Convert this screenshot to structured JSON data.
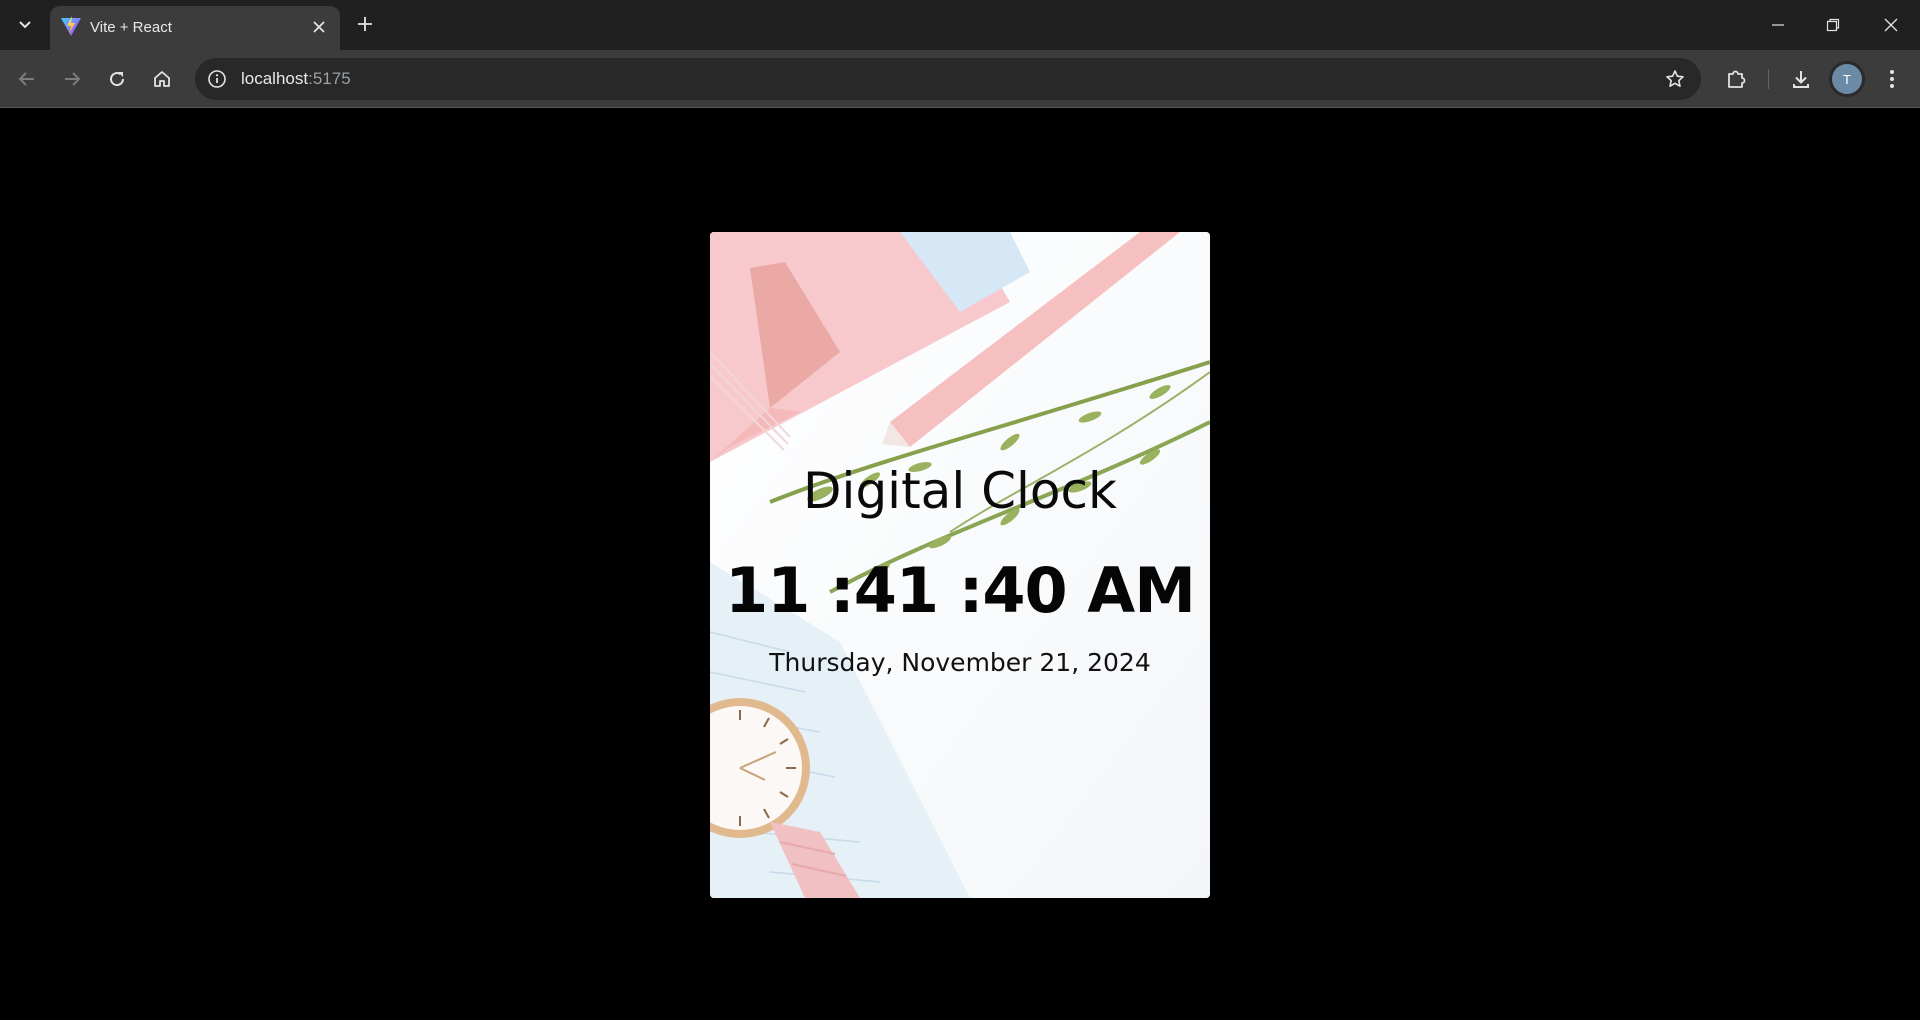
{
  "browser": {
    "tab": {
      "title": "Vite + React",
      "favicon": "vite-logo-icon"
    },
    "address_bar": {
      "host": "localhost",
      "port": ":5175"
    },
    "profile_initial": "T",
    "icons": [
      "tab-search-icon",
      "close-icon",
      "plus-icon",
      "minimize-icon",
      "restore-icon",
      "close-window-icon",
      "back-arrow-icon",
      "forward-arrow-icon",
      "reload-icon",
      "home-icon",
      "site-info-icon",
      "bookmark-star-icon",
      "extensions-icon",
      "download-icon",
      "kebab-menu-icon"
    ]
  },
  "page": {
    "background": "#000000",
    "clock": {
      "heading": "Digital Clock",
      "time": "11 :41 :40 AM",
      "date": "Thursday, November 21, 2024"
    }
  }
}
